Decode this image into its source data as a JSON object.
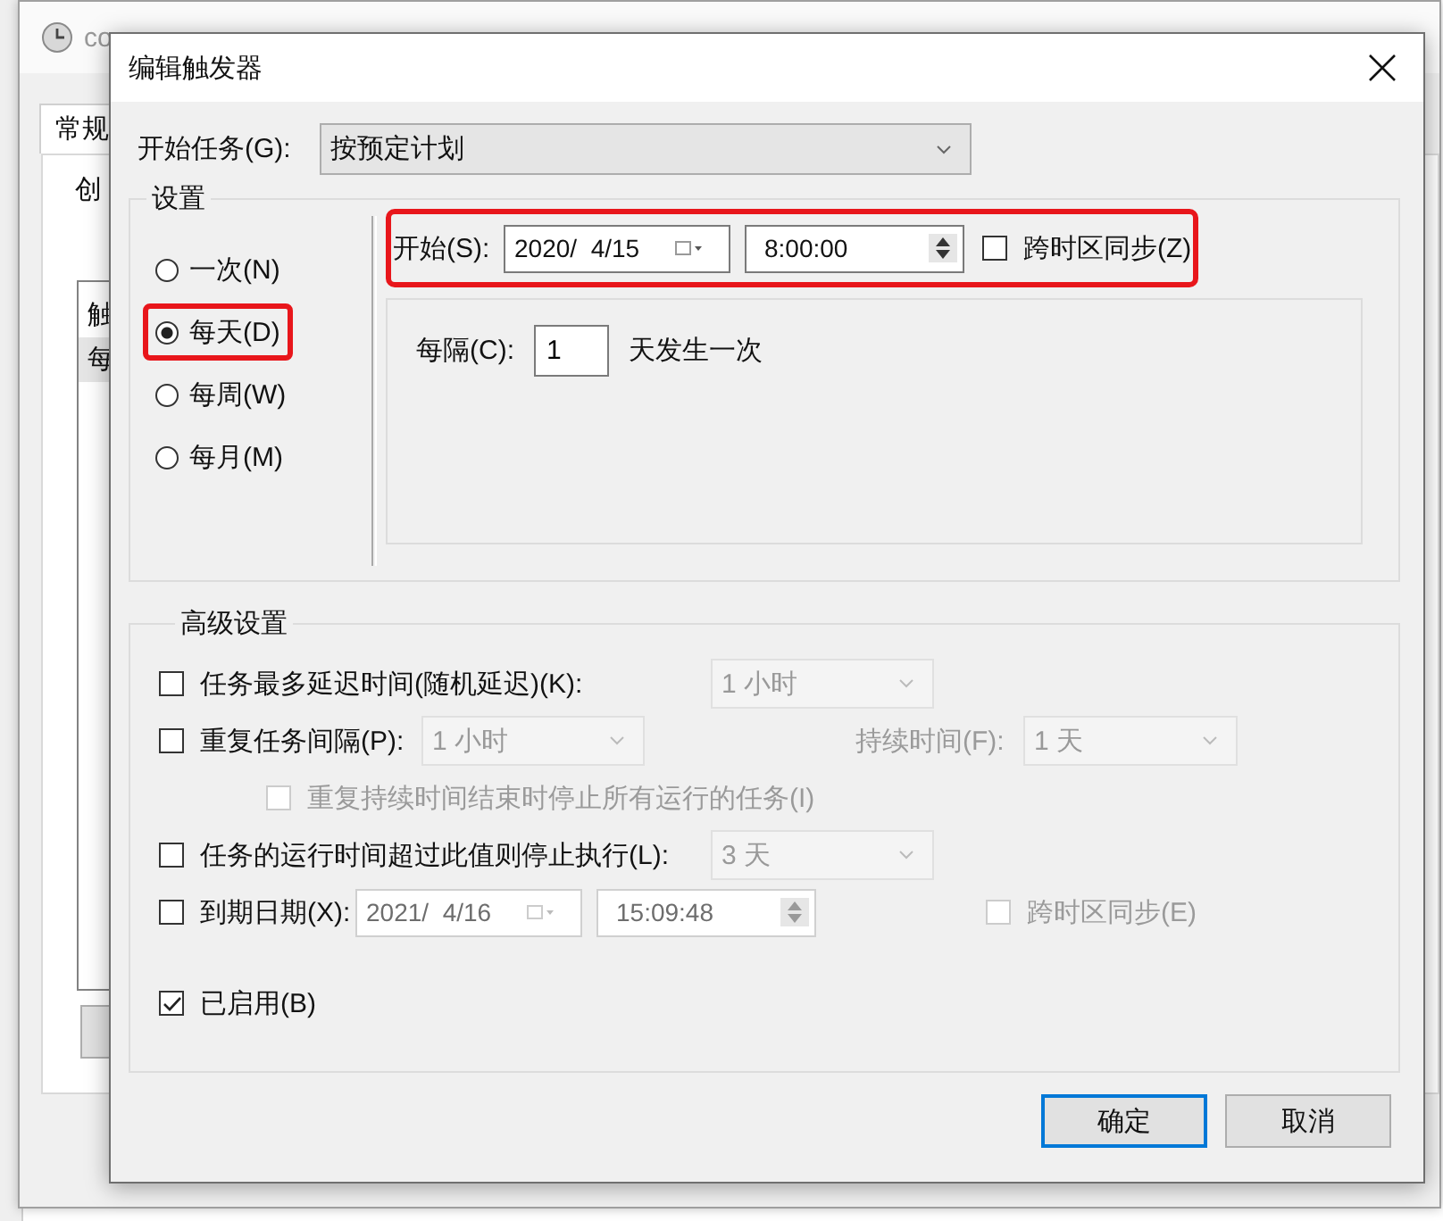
{
  "parent_window": {
    "title": "co",
    "tabs": [
      {
        "label": "常规",
        "selected": true
      }
    ],
    "section_label": "创",
    "list_items": [
      {
        "text": "触",
        "selected": false
      },
      {
        "text": "每",
        "selected": true
      }
    ]
  },
  "dialog": {
    "title": "编辑触发器",
    "begin_task": {
      "label": "开始任务(G):",
      "value": "按预定计划"
    },
    "settings": {
      "title": "设置",
      "schedule_options": [
        {
          "label": "一次(N)",
          "selected": false,
          "highlighted": false
        },
        {
          "label": "每天(D)",
          "selected": true,
          "highlighted": true
        },
        {
          "label": "每周(W)",
          "selected": false,
          "highlighted": false
        },
        {
          "label": "每月(M)",
          "selected": false,
          "highlighted": false
        }
      ],
      "start": {
        "label": "开始(S):",
        "date": "2020/  4/15",
        "time": "8:00:00",
        "sync_label": "跨时区同步(Z)",
        "sync_checked": false,
        "highlighted": true
      },
      "recur": {
        "label": "每隔(C):",
        "value": "1",
        "suffix": "天发生一次"
      }
    },
    "advanced": {
      "title": "高级设置",
      "options": [
        {
          "kind": "dropdown",
          "label": "任务最多延迟时间(随机延迟)(K):",
          "checked": false,
          "value": "1 小时"
        },
        {
          "kind": "repeat",
          "label": "重复任务间隔(P):",
          "checked": false,
          "value": "1 小时",
          "duration_label": "持续时间(F):",
          "duration_value": "1 天"
        },
        {
          "kind": "sub",
          "label": "重复持续时间结束时停止所有运行的任务(I)",
          "checked": false,
          "disabled": true
        },
        {
          "kind": "dropdown",
          "label": "任务的运行时间超过此值则停止执行(L):",
          "checked": false,
          "value": "3 天"
        },
        {
          "kind": "expire",
          "label": "到期日期(X):",
          "checked": false,
          "date": "2021/  4/16",
          "time": "15:09:48",
          "sync_label": "跨时区同步(E)",
          "sync_checked": false
        },
        {
          "kind": "plain",
          "label": "已启用(B)",
          "checked": true
        }
      ]
    },
    "buttons": [
      {
        "label": "确定",
        "default": true
      },
      {
        "label": "取消",
        "default": false
      }
    ]
  }
}
